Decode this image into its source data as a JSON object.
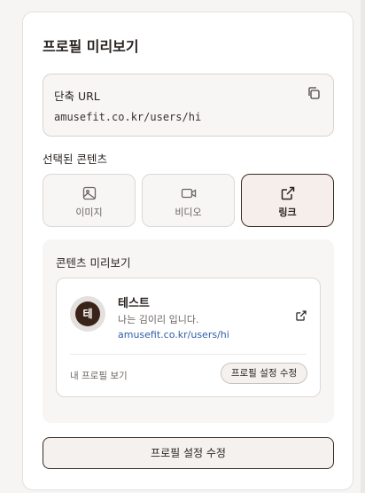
{
  "panel": {
    "title": "프로필 미리보기"
  },
  "short_url": {
    "label": "단축 URL",
    "value": "amusefit.co.kr/users/hi",
    "copy_icon": "copy-icon"
  },
  "content_selection": {
    "label": "선택된 콘텐츠",
    "options": [
      {
        "label": "이미지",
        "icon": "image-icon",
        "selected": false
      },
      {
        "label": "비디오",
        "icon": "video-icon",
        "selected": false
      },
      {
        "label": "링크",
        "icon": "external-link-icon",
        "selected": true
      }
    ]
  },
  "content_preview": {
    "label": "콘텐츠 미리보기",
    "profile": {
      "avatar_initial": "테",
      "name": "테스트",
      "bio": "나는 김이리 입니다.",
      "link": "amusefit.co.kr/users/hi",
      "link_icon": "external-link-icon"
    },
    "view_profile": "내 프로필 보기",
    "edit_button": "프로필 설정 수정"
  },
  "footer": {
    "edit_button": "프로필 설정 수정"
  },
  "colors": {
    "accent": "#3a2419",
    "link": "#2f5ea8",
    "selected_bg": "#f5eeea"
  }
}
